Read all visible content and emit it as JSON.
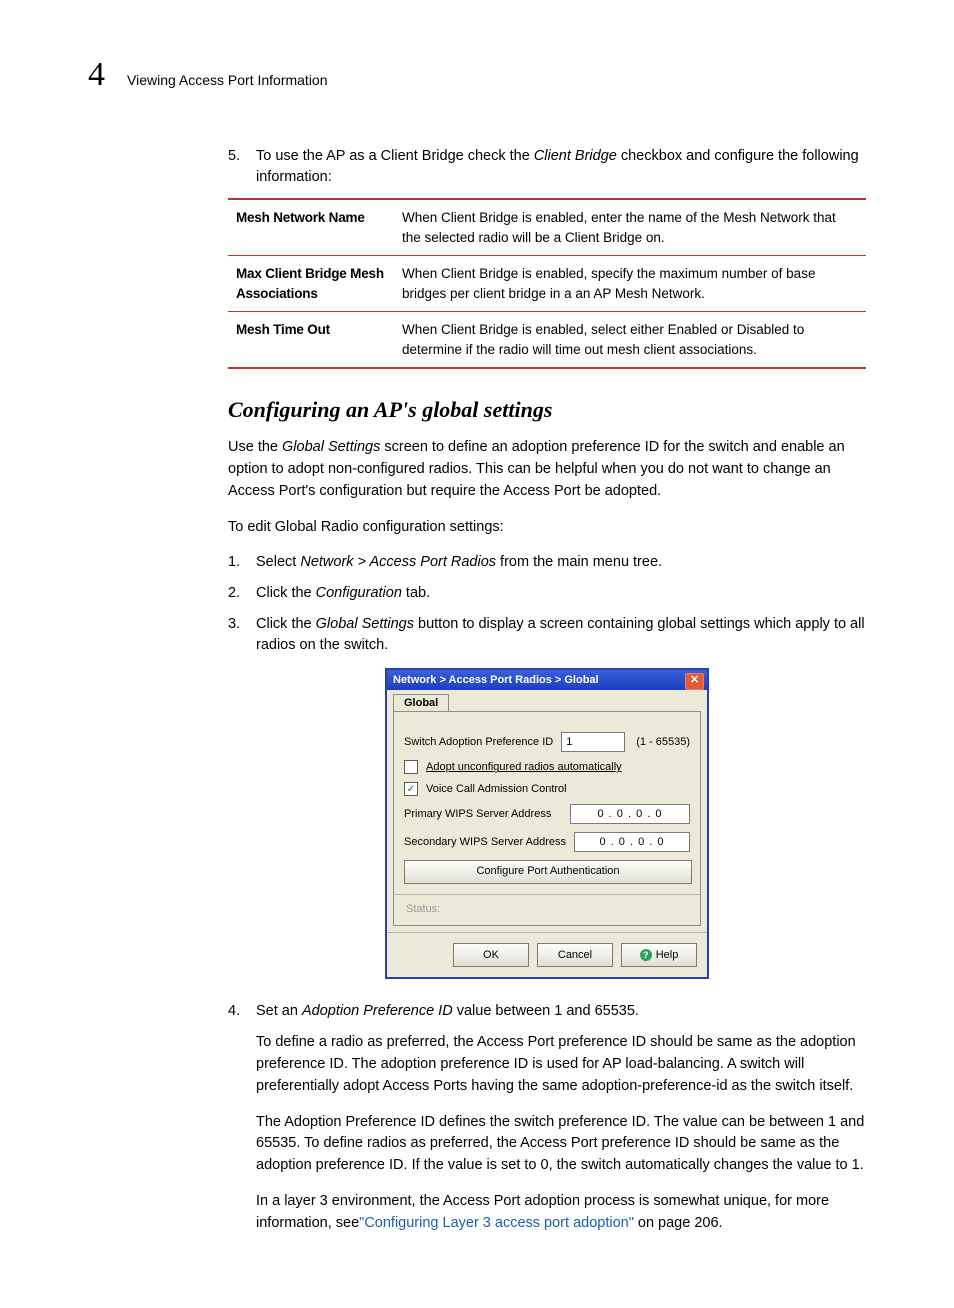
{
  "header": {
    "chapter": "4",
    "title": "Viewing Access Port Information"
  },
  "step5": {
    "num": "5.",
    "pre": "To use the AP as a Client Bridge check the ",
    "em": "Client Bridge",
    "post": " checkbox and configure the following information:"
  },
  "table": {
    "rows": [
      {
        "name": "Mesh Network Name",
        "desc": "When Client Bridge is enabled, enter the name of the Mesh Network that the selected radio will be a Client Bridge on."
      },
      {
        "name": "Max Client Bridge Mesh Associations",
        "desc": "When Client Bridge is enabled, specify the maximum number of base bridges per client bridge in a an AP Mesh Network."
      },
      {
        "name": "Mesh Time Out",
        "desc": "When Client Bridge is enabled, select either Enabled or Disabled to determine if the radio will time out mesh client associations."
      }
    ]
  },
  "section": {
    "heading": "Configuring an AP's global settings",
    "intro_pre": "Use the ",
    "intro_em": "Global Settings",
    "intro_post": " screen to define an adoption preference ID for the switch and enable an option to adopt non-configured radios. This can be helpful when you do not want to change an Access Port's configuration but require the Access Port be adopted.",
    "lead": "To edit Global Radio configuration settings:"
  },
  "steps": {
    "s1": {
      "num": "1.",
      "pre": "Select ",
      "em": "Network > Access Port Radios",
      "post": " from the main menu tree."
    },
    "s2": {
      "num": "2.",
      "pre": "Click the ",
      "em": "Configuration",
      "post": " tab."
    },
    "s3": {
      "num": "3.",
      "pre": "Click the ",
      "em": "Global Settings",
      "post": " button to display a screen containing global settings which apply to all radios on the switch."
    }
  },
  "dialog": {
    "titlebar": "Network > Access Port Radios > Global",
    "close": "✕",
    "tab": "Global",
    "fields": {
      "adopt_label": "Switch Adoption Preference ID",
      "adopt_value": "1",
      "adopt_hint": "(1 - 65535)",
      "unconf_label": "Adopt unconfigured radios automatically",
      "voice_label": "Voice Call Admission Control",
      "primary_label": "Primary WIPS Server Address",
      "secondary_label": "Secondary WIPS Server Address",
      "ip_value": "0  .  0  .  0  .  0",
      "cfg_btn": "Configure Port Authentication"
    },
    "status_label": "Status:",
    "actions": {
      "ok": "OK",
      "cancel": "Cancel",
      "help": "Help"
    }
  },
  "after": {
    "s4": {
      "num": "4.",
      "pre": "Set an ",
      "em": "Adoption Preference ID",
      "post": " value between 1 and 65535."
    },
    "p1": "To define a radio as preferred, the Access Port preference ID should be same as the adoption preference ID. The adoption preference ID is used for AP load-balancing. A switch will preferentially adopt Access Ports having the same adoption-preference-id as the switch itself.",
    "p2": "The Adoption Preference ID defines the switch preference ID. The value can be between 1 and 65535. To define radios as preferred, the Access Port preference ID should be same as the adoption preference ID. If the value is set to 0, the switch automatically changes the value to 1.",
    "p3_pre": "In a layer 3 environment, the Access Port adoption process is somewhat unique, for more information, see",
    "p3_link": "\"Configuring Layer 3 access port adoption\"",
    "p3_post": " on page 206."
  }
}
